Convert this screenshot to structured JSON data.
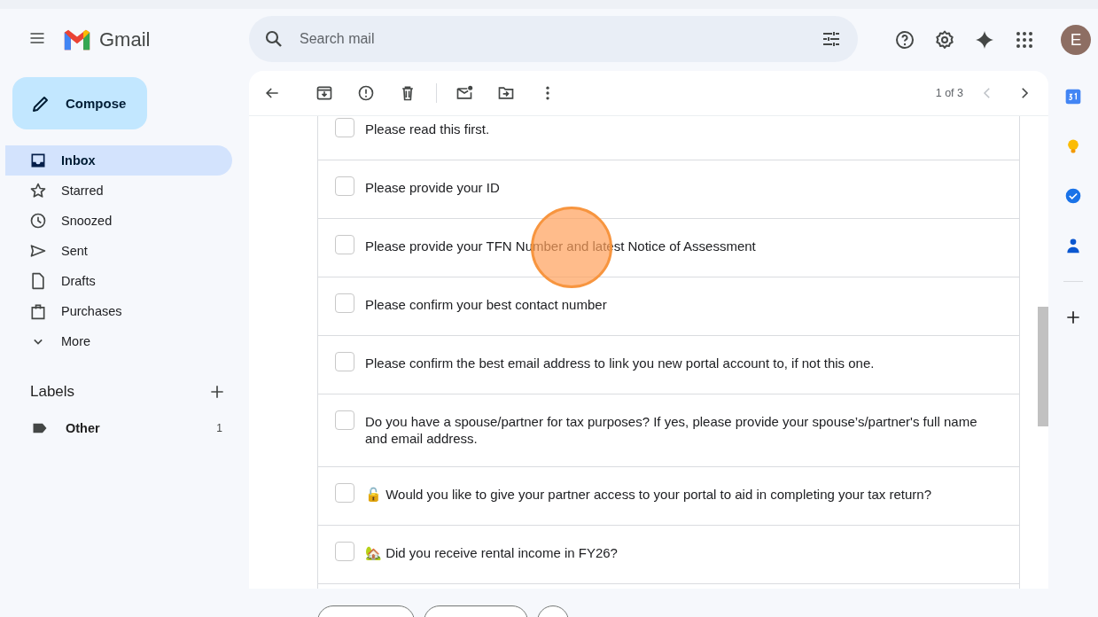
{
  "header": {
    "app_name": "Gmail",
    "search": {
      "placeholder": "Search mail"
    },
    "avatar_initial": "E"
  },
  "compose": "Compose",
  "nav": [
    {
      "label": "Inbox",
      "selected": true
    },
    {
      "label": "Starred",
      "selected": false
    },
    {
      "label": "Snoozed",
      "selected": false
    },
    {
      "label": "Sent",
      "selected": false
    },
    {
      "label": "Drafts",
      "selected": false
    },
    {
      "label": "Purchases",
      "selected": false
    },
    {
      "label": "More",
      "selected": false
    }
  ],
  "labels": {
    "title": "Labels",
    "items": [
      {
        "label": "Other",
        "count": "1"
      }
    ]
  },
  "toolbar": {
    "pager": "1 of 3"
  },
  "checklist": [
    {
      "text": "Please read this first.",
      "checked": false
    },
    {
      "text": "Please provide your ID",
      "checked": false
    },
    {
      "text": "Please provide your TFN Number and latest Notice of Assessment",
      "checked": false
    },
    {
      "text": "Please confirm your best contact number",
      "checked": false
    },
    {
      "text": "Please confirm the best email address to link you new portal account to, if not this one.",
      "checked": false
    },
    {
      "text": "Do you have a spouse/partner for tax purposes? If yes, please provide your spouse’s/partner's full name and email address.",
      "checked": false
    },
    {
      "text": "🔓 Would you like to give your partner access to your portal to aid in completing your tax return?",
      "checked": false
    },
    {
      "text": "🏡 Did you receive rental income in FY26?",
      "checked": false
    }
  ]
}
